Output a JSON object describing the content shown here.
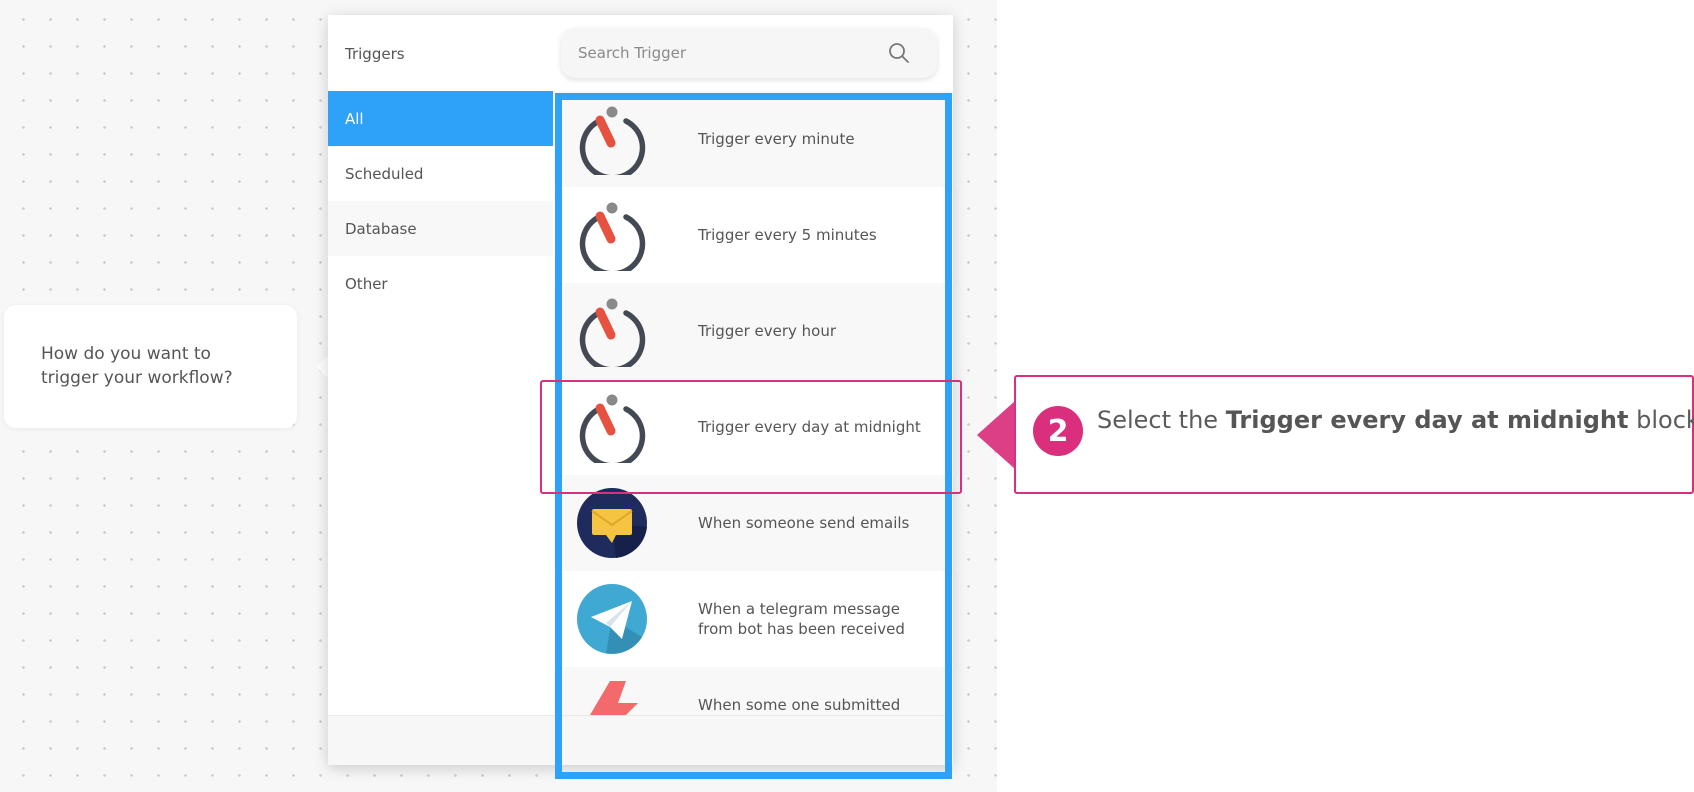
{
  "bubble": {
    "text": "How do you want to trigger your workflow?"
  },
  "panel": {
    "title": "Triggers",
    "search": {
      "placeholder": "Search Trigger",
      "icon": "search-icon"
    },
    "categories": [
      {
        "label": "All",
        "active": true
      },
      {
        "label": "Scheduled",
        "active": false
      },
      {
        "label": "Database",
        "active": false
      },
      {
        "label": "Other",
        "active": false
      }
    ],
    "triggers": [
      {
        "label": "Trigger every minute",
        "icon": "timer-icon"
      },
      {
        "label": "Trigger every 5 minutes",
        "icon": "timer-icon"
      },
      {
        "label": "Trigger every hour",
        "icon": "timer-icon"
      },
      {
        "label": "Trigger every day at midnight",
        "icon": "timer-icon"
      },
      {
        "label": "When someone send emails",
        "icon": "email-icon"
      },
      {
        "label": "When a telegram message from bot has been received",
        "icon": "telegram-icon"
      },
      {
        "label": "When some one submitted data to Complaints database",
        "icon": "lightning-icon"
      }
    ]
  },
  "callout": {
    "step": "2",
    "prefix": "Select the ",
    "emphasis": "Trigger every day at midnight",
    "suffix": " block"
  },
  "colors": {
    "accent": "#2ea1f8",
    "callout": "#d92f7c"
  }
}
